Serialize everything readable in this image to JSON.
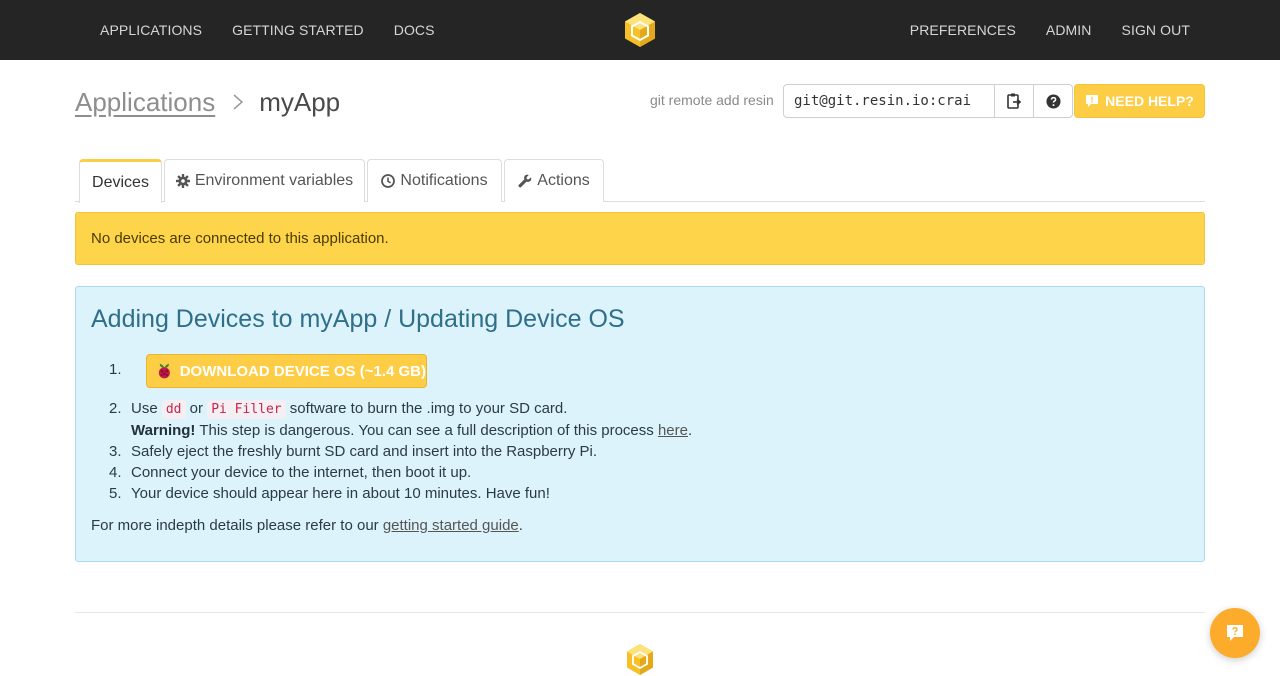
{
  "nav": {
    "left_items": [
      "APPLICATIONS",
      "GETTING STARTED",
      "DOCS"
    ],
    "right_items": [
      "PREFERENCES",
      "ADMIN",
      "SIGN OUT"
    ]
  },
  "breadcrumb": {
    "root": "Applications",
    "current": "myApp"
  },
  "git": {
    "label": "git remote add resin",
    "value": "git@git.resin.io:crai"
  },
  "help_button": "NEED HELP?",
  "tabs": [
    {
      "label": "Devices",
      "icon": "none",
      "active": true
    },
    {
      "label": "Environment variables",
      "icon": "gear-icon",
      "active": false
    },
    {
      "label": "Notifications",
      "icon": "clock-icon",
      "active": false
    },
    {
      "label": "Actions",
      "icon": "wrench-icon",
      "active": false
    }
  ],
  "alert": "No devices are connected to this application.",
  "panel": {
    "title": "Adding Devices to myApp / Updating Device OS",
    "download_label": "DOWNLOAD DEVICE OS (~1.4 GB)",
    "step_numbers": [
      "1.",
      "2.",
      "3.",
      "4.",
      "5."
    ],
    "step2": {
      "pre": "Use ",
      "code1": "dd",
      "mid": " or ",
      "code2": "Pi Filler",
      "post": " software to burn the .img to your SD card."
    },
    "warning": {
      "bold": "Warning!",
      "text": " This step is dangerous. You can see a full description of this process ",
      "link": "here",
      "end": "."
    },
    "step3": "Safely eject the freshly burnt SD card and insert into the Raspberry Pi.",
    "step4": "Connect your device to the internet, then boot it up.",
    "step5": "Your device should appear here in about 10 minutes. Have fun!",
    "footer": {
      "pre": "For more indepth details please refer to our ",
      "link": "getting started guide",
      "end": "."
    }
  },
  "colors": {
    "accent": "#fdcd45",
    "nav_bg": "#252525",
    "info_bg": "#dcf3fb",
    "chat": "#fdab2a"
  }
}
